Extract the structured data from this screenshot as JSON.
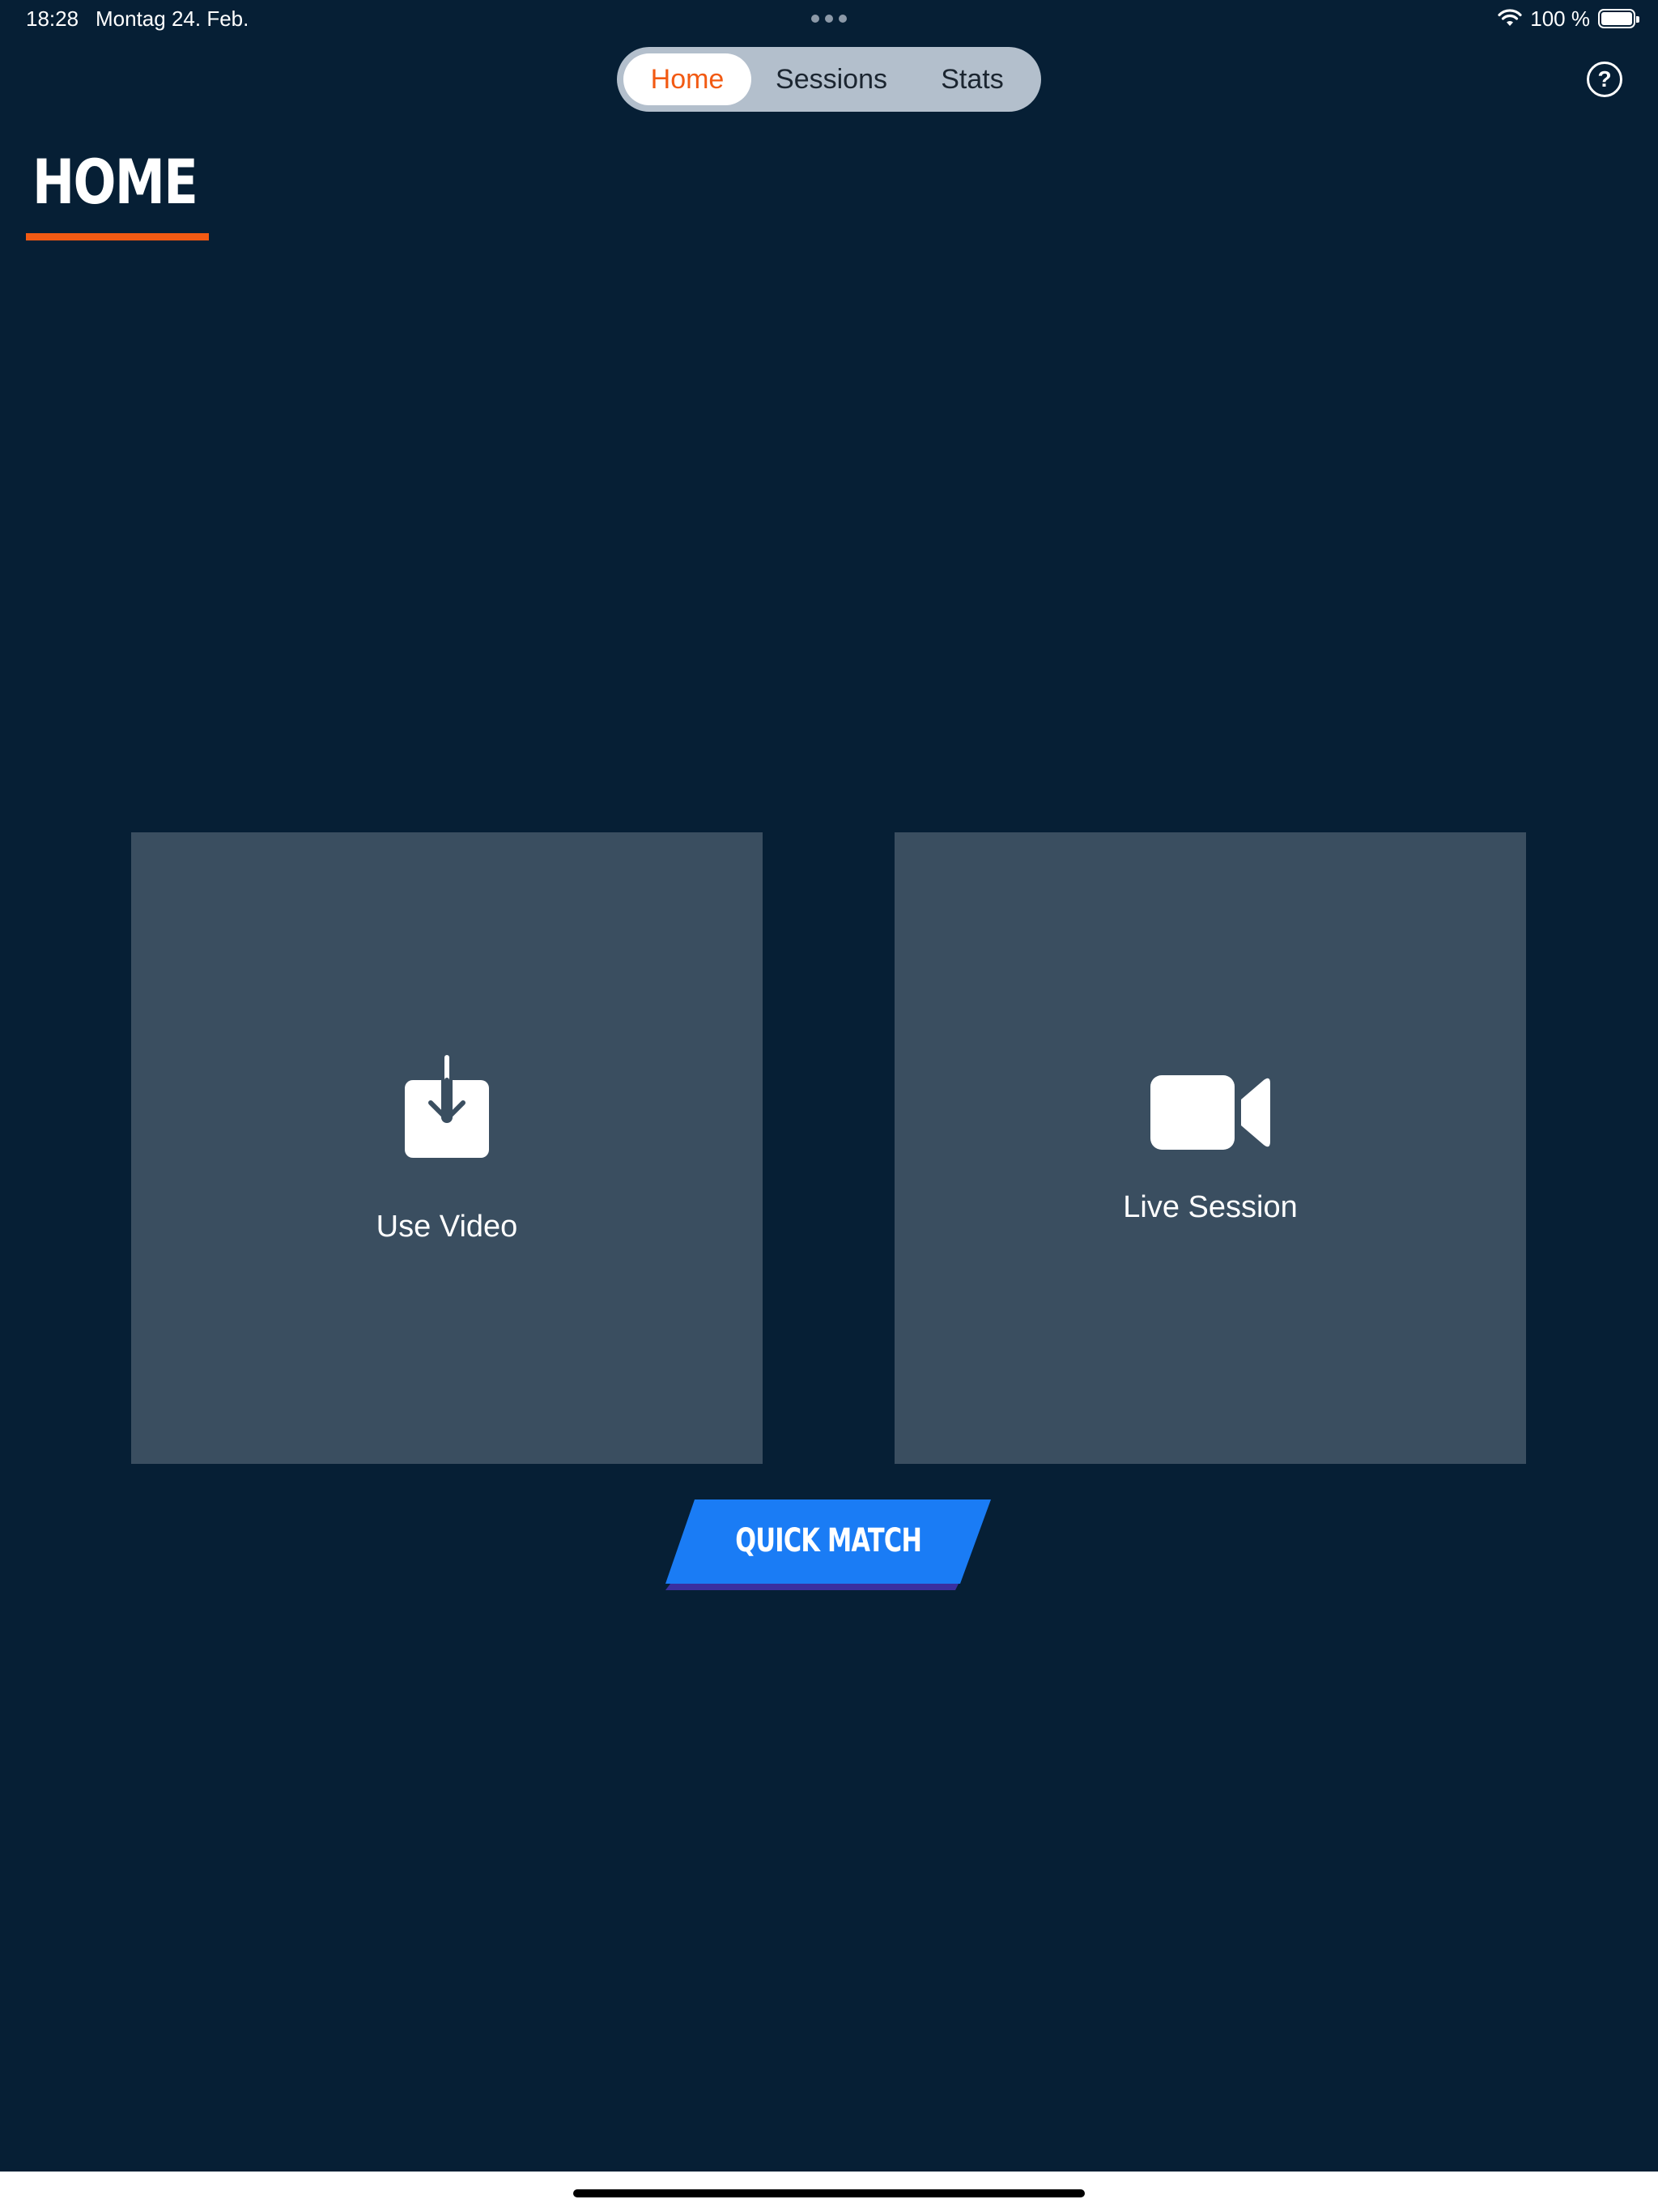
{
  "status_bar": {
    "time": "18:28",
    "date": "Montag 24. Feb.",
    "battery_percent": "100 %",
    "battery_level": 1.0,
    "icons": [
      "wifi-icon",
      "battery-icon"
    ]
  },
  "tabs": [
    {
      "label": "Home",
      "selected": true
    },
    {
      "label": "Sessions",
      "selected": false
    },
    {
      "label": "Stats",
      "selected": false
    }
  ],
  "help": {
    "label": "?",
    "icon": "question-circle-icon"
  },
  "page": {
    "title": "HOME"
  },
  "cards": {
    "use_video": {
      "label": "Use Video",
      "icon": "download-tray-icon"
    },
    "live_session": {
      "label": "Live Session",
      "icon": "video-camera-icon"
    }
  },
  "quick_match": {
    "label": "QUICK MATCH"
  },
  "colors": {
    "background": "#061f35",
    "card": "#3a4e60",
    "accent_orange": "#f25a13",
    "button_blue": "#1a7cf5",
    "button_shadow": "#3a2fa0",
    "segmented_bg": "#b3bfcc"
  }
}
